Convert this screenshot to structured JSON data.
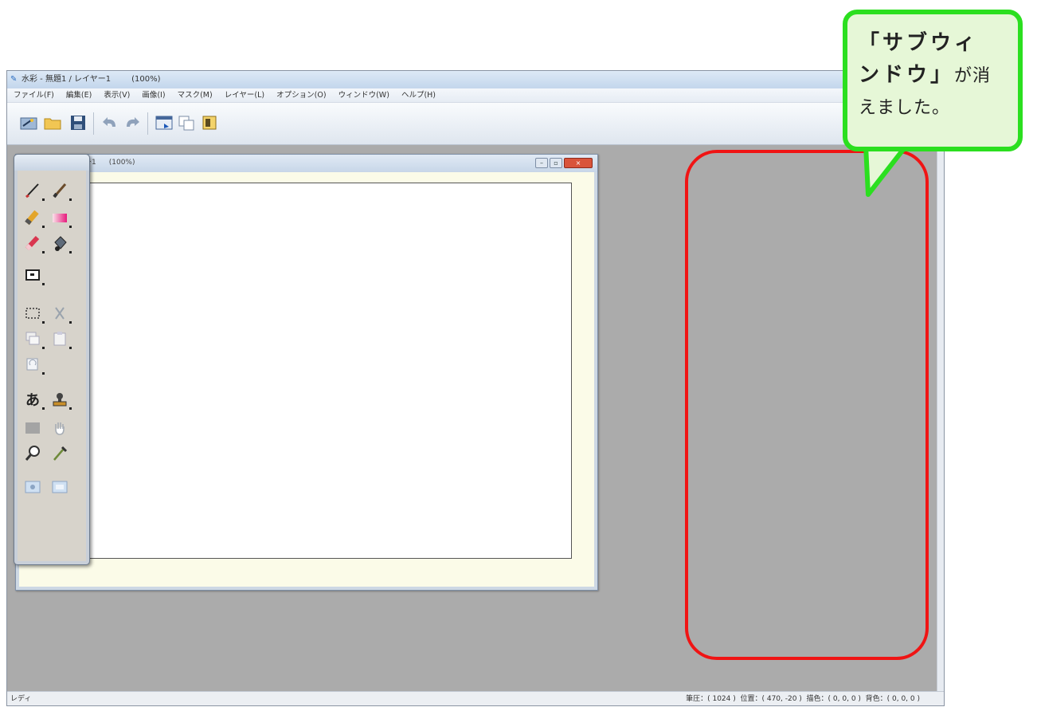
{
  "window": {
    "title": "水彩 - 無題1 / レイヤー1",
    "zoom": "(100%)"
  },
  "menu": [
    "ファイル(F)",
    "編集(E)",
    "表示(V)",
    "画像(I)",
    "マスク(M)",
    "レイヤー(L)",
    "オプション(O)",
    "ウィンドウ(W)",
    "ヘルプ(H)"
  ],
  "toolbar": {
    "icons": [
      "wizard-icon",
      "open-folder-icon",
      "save-icon",
      "undo-icon",
      "redo-icon",
      "screen-capture-icon",
      "copy-window-icon",
      "layers-icon"
    ]
  },
  "document": {
    "title_fragment": "ー1",
    "zoom": "(100%)"
  },
  "status": {
    "left": "レディ",
    "right": "筆圧：( 1024 )  位置：( 470, -20 )  描色：( 0, 0, 0 )  背色：( 0, 0, 0 )"
  },
  "callout": {
    "line1": "「サブウィ",
    "line2": "ンドウ」",
    "line2_tail": "が消",
    "line3": "えました。"
  },
  "colors": {
    "workspace": "#ababab",
    "callout_border": "#2bdf1f",
    "callout_fill": "#e6f7d7",
    "highlight": "#f01414"
  }
}
